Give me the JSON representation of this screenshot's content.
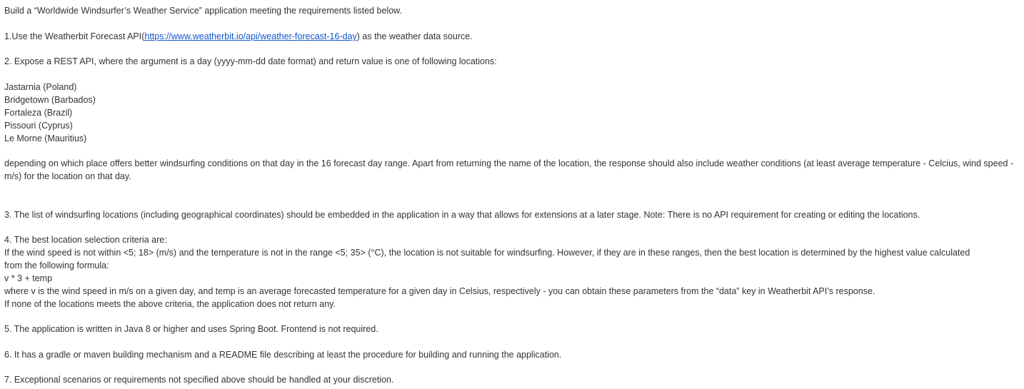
{
  "intro": "Build a “Worldwide Windsurfer’s Weather Service” application meeting the requirements listed below.",
  "req1": {
    "prefix": "1.Use the Weatherbit Forecast API(",
    "link_text": "https://www.weatherbit.io/api/weather-forecast-16-day",
    "suffix": ") as the weather data source."
  },
  "req2": {
    "text": "2. Expose a REST API, where the argument is a day (yyyy-mm-dd date format) and return value is one of following locations:",
    "locations": [
      "Jastarnia (Poland)",
      "Bridgetown (Barbados)",
      "Fortaleza (Brazil)",
      "Pissouri (Cyprus)",
      "Le Morne (Mauritius)"
    ],
    "after": "depending on which place offers better windsurfing conditions on that day in the 16 forecast day range. Apart from returning the name of the location, the response should also include weather conditions (at least average temperature - Celcius, wind speed - m/s) for the location on that day."
  },
  "req3": "3. The list of windsurfing locations (including geographical coordinates) should be embedded in the application in a way that allows for extensions at a later stage. Note: There is no API requirement for creating or editing the locations.",
  "req4": {
    "title": "4. The best location selection criteria are:",
    "para": "If the wind speed is not within <5; 18> (m/s) and the temperature is not in the range <5; 35> (°C), the location is not suitable for windsurfing. However, if they are in these ranges, then the best location is determined by the highest value calculated from the following formula:",
    "formula": "v * 3 + temp",
    "where": "where v is the wind speed in m/s on a given day, and temp is an average forecasted temperature for a given day in Celsius, respectively - you can obtain these parameters from the “data” key in Weatherbit API’s response.",
    "none": "If none of the locations meets the above criteria, the application does not return any."
  },
  "req5": "5. The application is written in Java 8 or higher and uses Spring Boot. Frontend is not required.",
  "req6": "6. It has a gradle or maven building mechanism and a README file describing at least the procedure for building and running the application.",
  "req7": "7. Exceptional scenarios or requirements not specified above should be handled at your discretion.",
  "colors": {
    "text": "#333333",
    "link": "#1155cc",
    "background": "#ffffff"
  }
}
